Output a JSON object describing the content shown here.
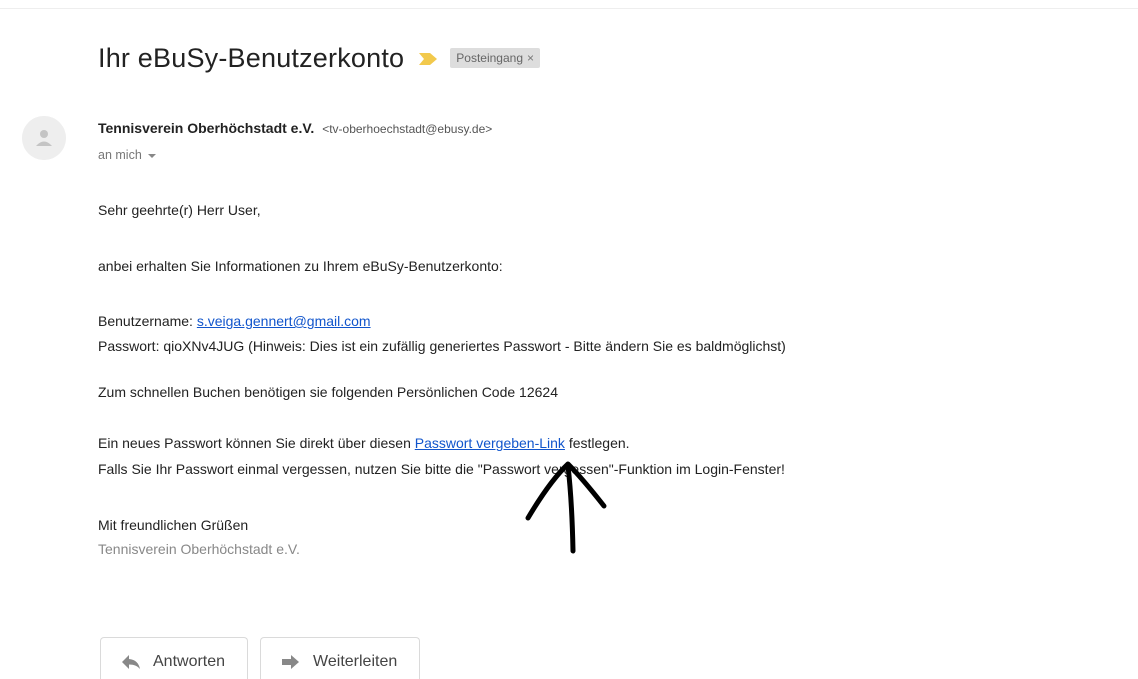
{
  "email": {
    "subject": "Ihr eBuSy-Benutzerkonto",
    "label": "Posteingang",
    "label_close": "×",
    "sender_name": "Tennisverein Oberhöchstadt e.V.",
    "sender_email": "<tv-oberhoechstadt@ebusy.de>",
    "recipient": "an mich"
  },
  "body": {
    "greeting": "Sehr geehrte(r) Herr User,",
    "intro": "anbei erhalten Sie Informationen zu Ihrem eBuSy-Benutzerkonto:",
    "username_label": "Benutzername: ",
    "username_value": "s.veiga.gennert@gmail.com",
    "password_line": "Passwort: qioXNv4JUG (Hinweis: Dies ist ein zufällig generiertes Passwort - Bitte ändern Sie es baldmöglichst)",
    "code_line": "Zum schnellen Buchen benötigen sie folgenden Persönlichen Code 12624",
    "newpw_prefix": "Ein neues Passwort können Sie direkt über diesen ",
    "newpw_link": "Passwort vergeben-Link",
    "newpw_suffix": " festlegen.",
    "forgot_line": "Falls Sie Ihr Passwort einmal vergessen, nutzen Sie bitte die \"Passwort vergessen\"-Funktion im Login-Fenster!",
    "closing": "Mit freundlichen Grüßen",
    "signature": "Tennisverein Oberhöchstadt e.V."
  },
  "actions": {
    "reply": "Antworten",
    "forward": "Weiterleiten"
  },
  "icons": {
    "importance": "importance-marker-icon",
    "avatar": "default-avatar-icon",
    "reply": "reply-arrow-icon",
    "forward": "forward-arrow-icon",
    "annotation": "hand-drawn-arrow-icon"
  },
  "colors": {
    "link": "#1155cc",
    "importance": "#f2c94c",
    "label_chip": "#dddddd"
  }
}
